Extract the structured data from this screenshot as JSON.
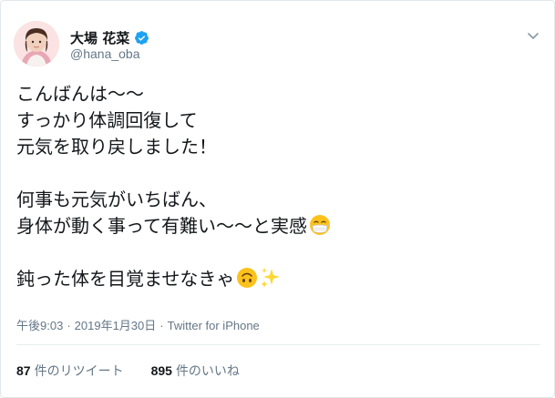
{
  "tweet": {
    "author": {
      "name": "大場 花菜",
      "handle": "@hana_oba",
      "verified": true
    },
    "lines": [
      "こんばんは〜〜",
      "すっかり体調回復して",
      "元気を取り戻しました！",
      "",
      "何事も元気がいちばん、",
      "身体が動く事って有難い〜〜と実感",
      "",
      "鈍った体を目覚ませなきゃ"
    ],
    "emojis": {
      "line6": "mask-face",
      "line8": [
        "upside-down-face",
        "sparkles"
      ]
    },
    "time": "午後9:03",
    "separator": "·",
    "date": "2019年1月30日",
    "source": "Twitter for iPhone",
    "retweets": {
      "count": "87",
      "label": "件のリツイート"
    },
    "likes": {
      "count": "895",
      "label": "件のいいね"
    }
  },
  "colors": {
    "verified_blue": "#1da1f2",
    "text": "#14171a",
    "secondary": "#657786"
  }
}
